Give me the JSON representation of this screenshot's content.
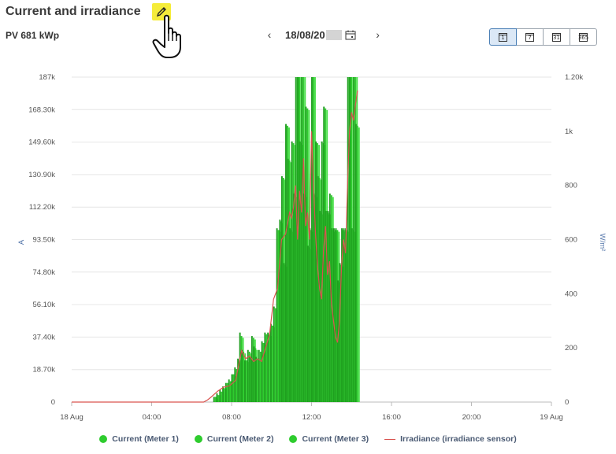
{
  "header": {
    "title": "Current and irradiance",
    "subtitle": "PV 681 kWp",
    "date_text": "18/08/20",
    "prev_label": "‹",
    "next_label": "›"
  },
  "period_buttons": [
    {
      "label": "1",
      "active": true
    },
    {
      "label": "7",
      "active": false
    },
    {
      "label": "31",
      "active": false
    },
    {
      "label": "365",
      "active": false
    }
  ],
  "colors": {
    "current": "#2ecc2e",
    "current_dark": "#1e9e1e",
    "irradiance": "#d9534f",
    "grid": "#e6e6e6",
    "axis_text": "#555555",
    "highlight": "#f5ec3a"
  },
  "chart_data": {
    "type": "bar",
    "title": "",
    "xlabel": "",
    "ylabel_left": "A",
    "ylabel_right": "W/m²",
    "left_ticks": [
      "0",
      "18.70k",
      "37.40k",
      "56.10k",
      "74.80k",
      "93.50k",
      "112.20k",
      "130.90k",
      "149.60k",
      "168.30k",
      "187k"
    ],
    "left_ylim": [
      0,
      187000
    ],
    "right_ticks": [
      "0",
      "200",
      "400",
      "600",
      "800",
      "1k",
      "1.20k"
    ],
    "right_ylim": [
      0,
      1200
    ],
    "x_ticks": [
      "18 Aug",
      "04:00",
      "08:00",
      "12:00",
      "16:00",
      "20:00",
      "19 Aug"
    ],
    "x_range_hours": [
      0,
      24
    ],
    "grid": true,
    "legend_position": "bottom",
    "bar_hours": [
      7.2,
      7.35,
      7.5,
      7.65,
      7.8,
      7.95,
      8.1,
      8.25,
      8.4,
      8.5,
      8.6,
      8.75,
      8.9,
      9.0,
      9.1,
      9.2,
      9.3,
      9.45,
      9.6,
      9.75,
      9.9,
      10.05,
      10.2,
      10.35,
      10.5,
      10.6,
      10.7,
      10.8,
      10.9,
      11.0,
      11.1,
      11.2,
      11.3,
      11.4,
      11.5,
      11.6,
      11.7,
      11.8,
      11.9,
      12.0,
      12.1,
      12.2,
      12.3,
      12.4,
      12.5,
      12.6,
      12.7,
      12.8,
      12.9,
      13.0,
      13.1,
      13.2,
      13.3,
      13.4,
      13.5,
      13.6,
      13.7,
      13.8,
      13.9,
      14.0,
      14.1,
      14.2,
      14.3
    ],
    "series": [
      {
        "name": "Current (Meter 1)",
        "values": [
          3000,
          5000,
          7000,
          9000,
          11000,
          13000,
          16000,
          20000,
          25000,
          40000,
          30000,
          24000,
          30000,
          26000,
          38000,
          32000,
          26000,
          30000,
          35000,
          40000,
          40000,
          45000,
          55000,
          100000,
          105000,
          130000,
          80000,
          160000,
          140000,
          100000,
          150000,
          120000,
          187000,
          187000,
          150000,
          187000,
          120000,
          170000,
          90000,
          100000,
          187000,
          120000,
          150000,
          130000,
          110000,
          150000,
          170000,
          110000,
          110000,
          120000,
          100000,
          100000,
          100000,
          70000,
          80000,
          100000,
          100000,
          100000,
          187000,
          187000,
          100000,
          187000,
          160000
        ]
      },
      {
        "name": "Current (Meter 2)",
        "values": [
          3000,
          4000,
          6000,
          8000,
          11000,
          12000,
          16000,
          19000,
          24000,
          38000,
          29000,
          24000,
          29000,
          25000,
          37000,
          31000,
          25000,
          29000,
          34000,
          39000,
          39000,
          44000,
          54000,
          99000,
          104000,
          129000,
          79000,
          159000,
          139000,
          99000,
          149000,
          119000,
          187000,
          187000,
          149000,
          187000,
          119000,
          169000,
          89000,
          99000,
          187000,
          119000,
          149000,
          129000,
          109000,
          149000,
          169000,
          109000,
          109000,
          119000,
          99000,
          99000,
          99000,
          69000,
          79000,
          99000,
          99000,
          99000,
          187000,
          187000,
          99000,
          187000,
          159000
        ]
      },
      {
        "name": "Current (Meter 3)",
        "values": [
          2000,
          4000,
          6000,
          8000,
          10000,
          12000,
          15000,
          19000,
          24000,
          37000,
          28000,
          23000,
          28000,
          24000,
          36000,
          30000,
          24000,
          28000,
          33000,
          38000,
          38000,
          43000,
          53000,
          98000,
          103000,
          128000,
          78000,
          158000,
          138000,
          98000,
          148000,
          118000,
          187000,
          187000,
          148000,
          187000,
          118000,
          168000,
          88000,
          98000,
          187000,
          118000,
          148000,
          128000,
          108000,
          148000,
          168000,
          108000,
          108000,
          118000,
          98000,
          98000,
          98000,
          68000,
          78000,
          98000,
          98000,
          98000,
          187000,
          187000,
          98000,
          187000,
          158000
        ]
      },
      {
        "name": "Irradiance (irradiance sensor)",
        "x": [
          0,
          6.6,
          6.8,
          7.0,
          7.3,
          7.6,
          7.9,
          8.2,
          8.5,
          8.7,
          8.9,
          9.1,
          9.3,
          9.5,
          9.7,
          9.9,
          10.1,
          10.3,
          10.5,
          10.7,
          10.9,
          11.0,
          11.1,
          11.2,
          11.3,
          11.4,
          11.5,
          11.6,
          11.7,
          11.8,
          11.9,
          12.0,
          12.1,
          12.2,
          12.3,
          12.4,
          12.5,
          12.6,
          12.7,
          12.8,
          12.9,
          13.0,
          13.1,
          13.2,
          13.3,
          13.4,
          13.5,
          13.6,
          13.7,
          13.8,
          13.9,
          14.0,
          14.1,
          14.2,
          14.3
        ],
        "values": [
          0,
          0,
          8,
          20,
          40,
          55,
          60,
          80,
          190,
          160,
          170,
          150,
          160,
          150,
          200,
          250,
          380,
          420,
          600,
          620,
          700,
          680,
          720,
          800,
          600,
          780,
          700,
          900,
          650,
          700,
          600,
          1000,
          800,
          620,
          500,
          420,
          380,
          560,
          650,
          470,
          520,
          360,
          300,
          240,
          220,
          300,
          500,
          600,
          550,
          800,
          1000,
          1070,
          1040,
          1100,
          1150
        ]
      }
    ]
  }
}
